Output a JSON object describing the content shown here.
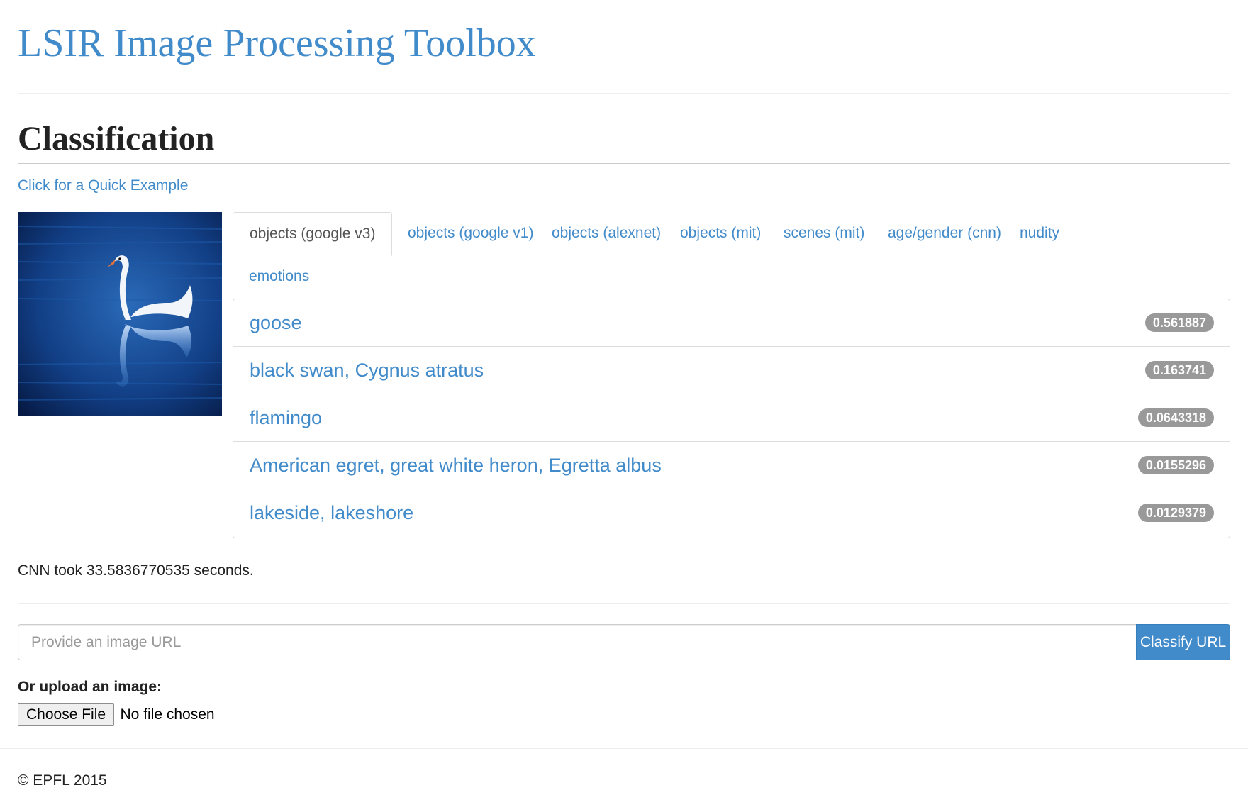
{
  "site": {
    "title": "LSIR Image Processing Toolbox"
  },
  "section": {
    "title": "Classification",
    "quick_example": "Click for a Quick Example"
  },
  "tabs": [
    {
      "label": "objects (google v3)",
      "active": true
    },
    {
      "label": "objects (google v1)",
      "active": false
    },
    {
      "label": "objects (alexnet)",
      "active": false
    },
    {
      "label": "objects (mit)",
      "active": false
    },
    {
      "label": "scenes (mit)",
      "active": false
    },
    {
      "label": "age/gender (cnn)",
      "active": false
    },
    {
      "label": "nudity",
      "active": false
    },
    {
      "label": "emotions",
      "active": false
    }
  ],
  "results": [
    {
      "label": "goose",
      "score": "0.561887"
    },
    {
      "label": "black swan, Cygnus atratus",
      "score": "0.163741"
    },
    {
      "label": "flamingo",
      "score": "0.0643318"
    },
    {
      "label": "American egret, great white heron, Egretta albus",
      "score": "0.0155296"
    },
    {
      "label": "lakeside, lakeshore",
      "score": "0.0129379"
    }
  ],
  "timing": "CNN took 33.5836770535 seconds.",
  "url_form": {
    "placeholder": "Provide an image URL",
    "value": "",
    "button": "Classify URL"
  },
  "upload": {
    "label": "Or upload an image:",
    "button": "Choose File",
    "status": "No file chosen"
  },
  "footer": {
    "text": "© EPFL 2015"
  },
  "colors": {
    "link": "#428bca",
    "badge": "#999999",
    "primary_button": "#428bca"
  }
}
